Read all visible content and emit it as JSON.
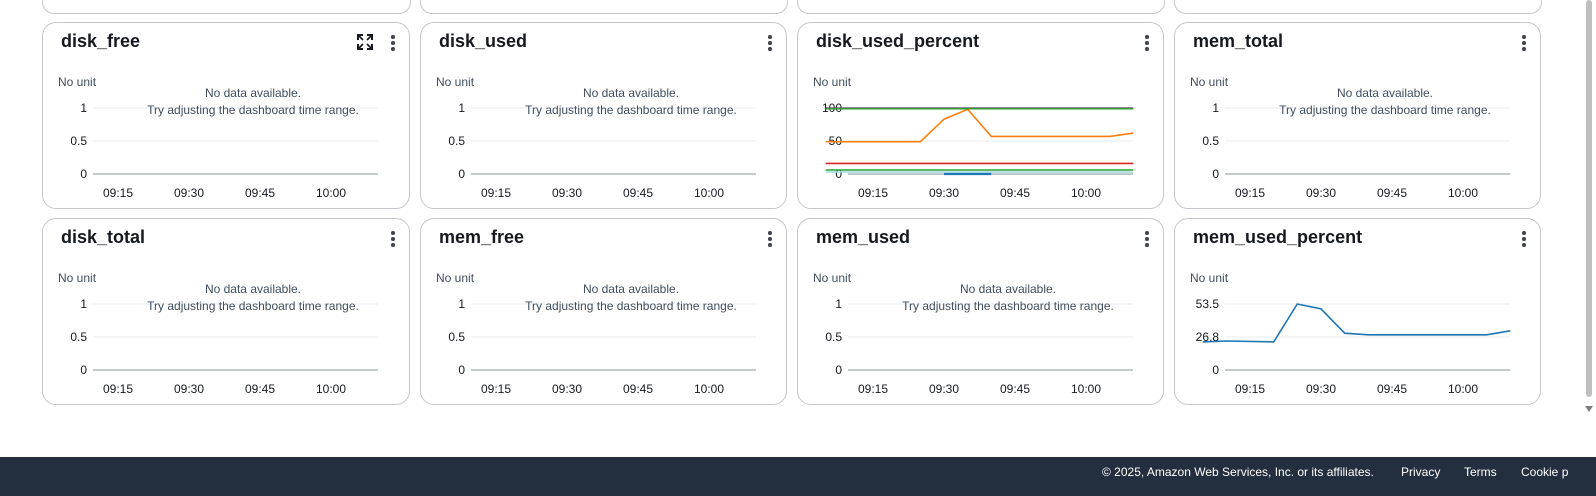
{
  "widgets": [
    {
      "title": "disk_free",
      "unit": "No unit",
      "has_expand": true,
      "no_data": true,
      "y_ticks": [
        "1",
        "0.5",
        "0"
      ],
      "x_ticks": [
        "09:15",
        "09:30",
        "09:45",
        "10:00"
      ]
    },
    {
      "title": "disk_used",
      "unit": "No unit",
      "has_expand": false,
      "no_data": true,
      "y_ticks": [
        "1",
        "0.5",
        "0"
      ],
      "x_ticks": [
        "09:15",
        "09:30",
        "09:45",
        "10:00"
      ]
    },
    {
      "title": "disk_used_percent",
      "unit": "No unit",
      "has_expand": false,
      "no_data": false,
      "y_ticks": [
        "100",
        "50",
        "0"
      ],
      "x_ticks": [
        "09:15",
        "09:30",
        "09:45",
        "10:00"
      ]
    },
    {
      "title": "mem_total",
      "unit": "No unit",
      "has_expand": false,
      "no_data": true,
      "y_ticks": [
        "1",
        "0.5",
        "0"
      ],
      "x_ticks": [
        "09:15",
        "09:30",
        "09:45",
        "10:00"
      ]
    },
    {
      "title": "disk_total",
      "unit": "No unit",
      "has_expand": false,
      "no_data": true,
      "y_ticks": [
        "1",
        "0.5",
        "0"
      ],
      "x_ticks": [
        "09:15",
        "09:30",
        "09:45",
        "10:00"
      ]
    },
    {
      "title": "mem_free",
      "unit": "No unit",
      "has_expand": false,
      "no_data": true,
      "y_ticks": [
        "1",
        "0.5",
        "0"
      ],
      "x_ticks": [
        "09:15",
        "09:30",
        "09:45",
        "10:00"
      ]
    },
    {
      "title": "mem_used",
      "unit": "No unit",
      "has_expand": false,
      "no_data": true,
      "y_ticks": [
        "1",
        "0.5",
        "0"
      ],
      "x_ticks": [
        "09:15",
        "09:30",
        "09:45",
        "10:00"
      ]
    },
    {
      "title": "mem_used_percent",
      "unit": "No unit",
      "has_expand": false,
      "no_data": false,
      "y_ticks": [
        "53.5",
        "26.8",
        "0"
      ],
      "x_ticks": [
        "09:15",
        "09:30",
        "09:45",
        "10:00"
      ]
    }
  ],
  "no_data_line1": "No data available.",
  "no_data_line2": "Try adjusting the dashboard time range.",
  "chart_data": [
    {
      "type": "line",
      "title": "disk_used_percent",
      "ylabel": "No unit",
      "x_ticks": [
        "09:15",
        "09:30",
        "09:45",
        "10:00"
      ],
      "x_unit": "minutes since 09:00",
      "ylim": [
        0,
        100
      ],
      "series": [
        {
          "color": "#8c4a8e",
          "x": [
            5,
            70
          ],
          "values": [
            100,
            100
          ]
        },
        {
          "color": "#ff7f0e",
          "x": [
            5,
            20,
            25,
            30,
            35,
            40,
            55,
            65,
            70
          ],
          "values": [
            49,
            49,
            49,
            83,
            98,
            57,
            57,
            57,
            62
          ]
        },
        {
          "color": "#2ca02c",
          "x": [
            5,
            70
          ],
          "values": [
            99,
            99
          ]
        },
        {
          "color": "#d62728",
          "x": [
            5,
            70
          ],
          "values": [
            16,
            16
          ]
        },
        {
          "color": "#2ca02c",
          "x": [
            5,
            70
          ],
          "values": [
            6,
            6
          ]
        },
        {
          "color": "#9edae5",
          "x": [
            5,
            70
          ],
          "values": [
            3,
            3
          ]
        },
        {
          "color": "#1f77b4",
          "x": [
            30,
            40
          ],
          "values": [
            0,
            0
          ]
        }
      ],
      "grid": true,
      "legend": "none"
    },
    {
      "type": "line",
      "title": "mem_used_percent",
      "ylabel": "No unit",
      "x_ticks": [
        "09:15",
        "09:30",
        "09:45",
        "10:00"
      ],
      "x_unit": "minutes since 09:00",
      "ylim": [
        0,
        53.5
      ],
      "series": [
        {
          "color": "#1f77b4",
          "x": [
            5,
            10,
            20,
            25,
            30,
            35,
            40,
            55,
            60,
            65,
            70
          ],
          "values": [
            22.8,
            23.5,
            22.8,
            53.5,
            49.5,
            29.8,
            28.5,
            28.5,
            28.5,
            28.5,
            31.8
          ]
        }
      ],
      "grid": true,
      "legend": "none"
    }
  ],
  "footer": {
    "copyright": "© 2025, Amazon Web Services, Inc. or its affiliates.",
    "privacy": "Privacy",
    "terms": "Terms",
    "cookies": "Cookie p"
  }
}
